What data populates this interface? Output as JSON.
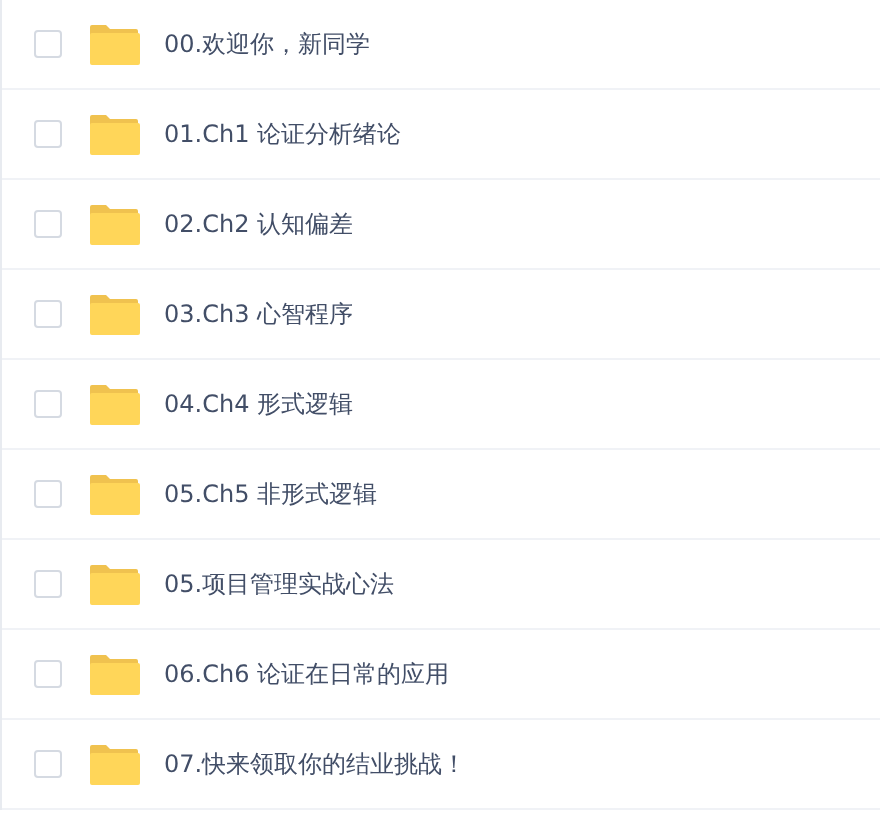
{
  "files": [
    {
      "name": "00.欢迎你，新同学",
      "checked": false
    },
    {
      "name": "01.Ch1 论证分析绪论",
      "checked": false
    },
    {
      "name": "02.Ch2 认知偏差",
      "checked": false
    },
    {
      "name": "03.Ch3 心智程序",
      "checked": false
    },
    {
      "name": "04.Ch4 形式逻辑",
      "checked": false
    },
    {
      "name": "05.Ch5 非形式逻辑",
      "checked": false
    },
    {
      "name": "05.项目管理实战心法",
      "checked": false
    },
    {
      "name": "06.Ch6 论证在日常的应用",
      "checked": false
    },
    {
      "name": "07.快来领取你的结业挑战！",
      "checked": false
    }
  ]
}
